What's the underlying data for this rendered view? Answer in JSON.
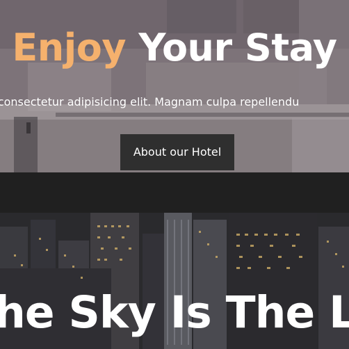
{
  "hero": {
    "title_accent": "Enjoy",
    "title_rest": " Your Stay",
    "subtitle": "met consectetur adipisicing elit. Magnam culpa repellendu",
    "button_label": "About our Hotel"
  },
  "city": {
    "title": "he Sky Is The Limi"
  },
  "colors": {
    "accent": "#f5b16d",
    "button_bg": "#2f2f2f",
    "band_bg": "#202020"
  }
}
